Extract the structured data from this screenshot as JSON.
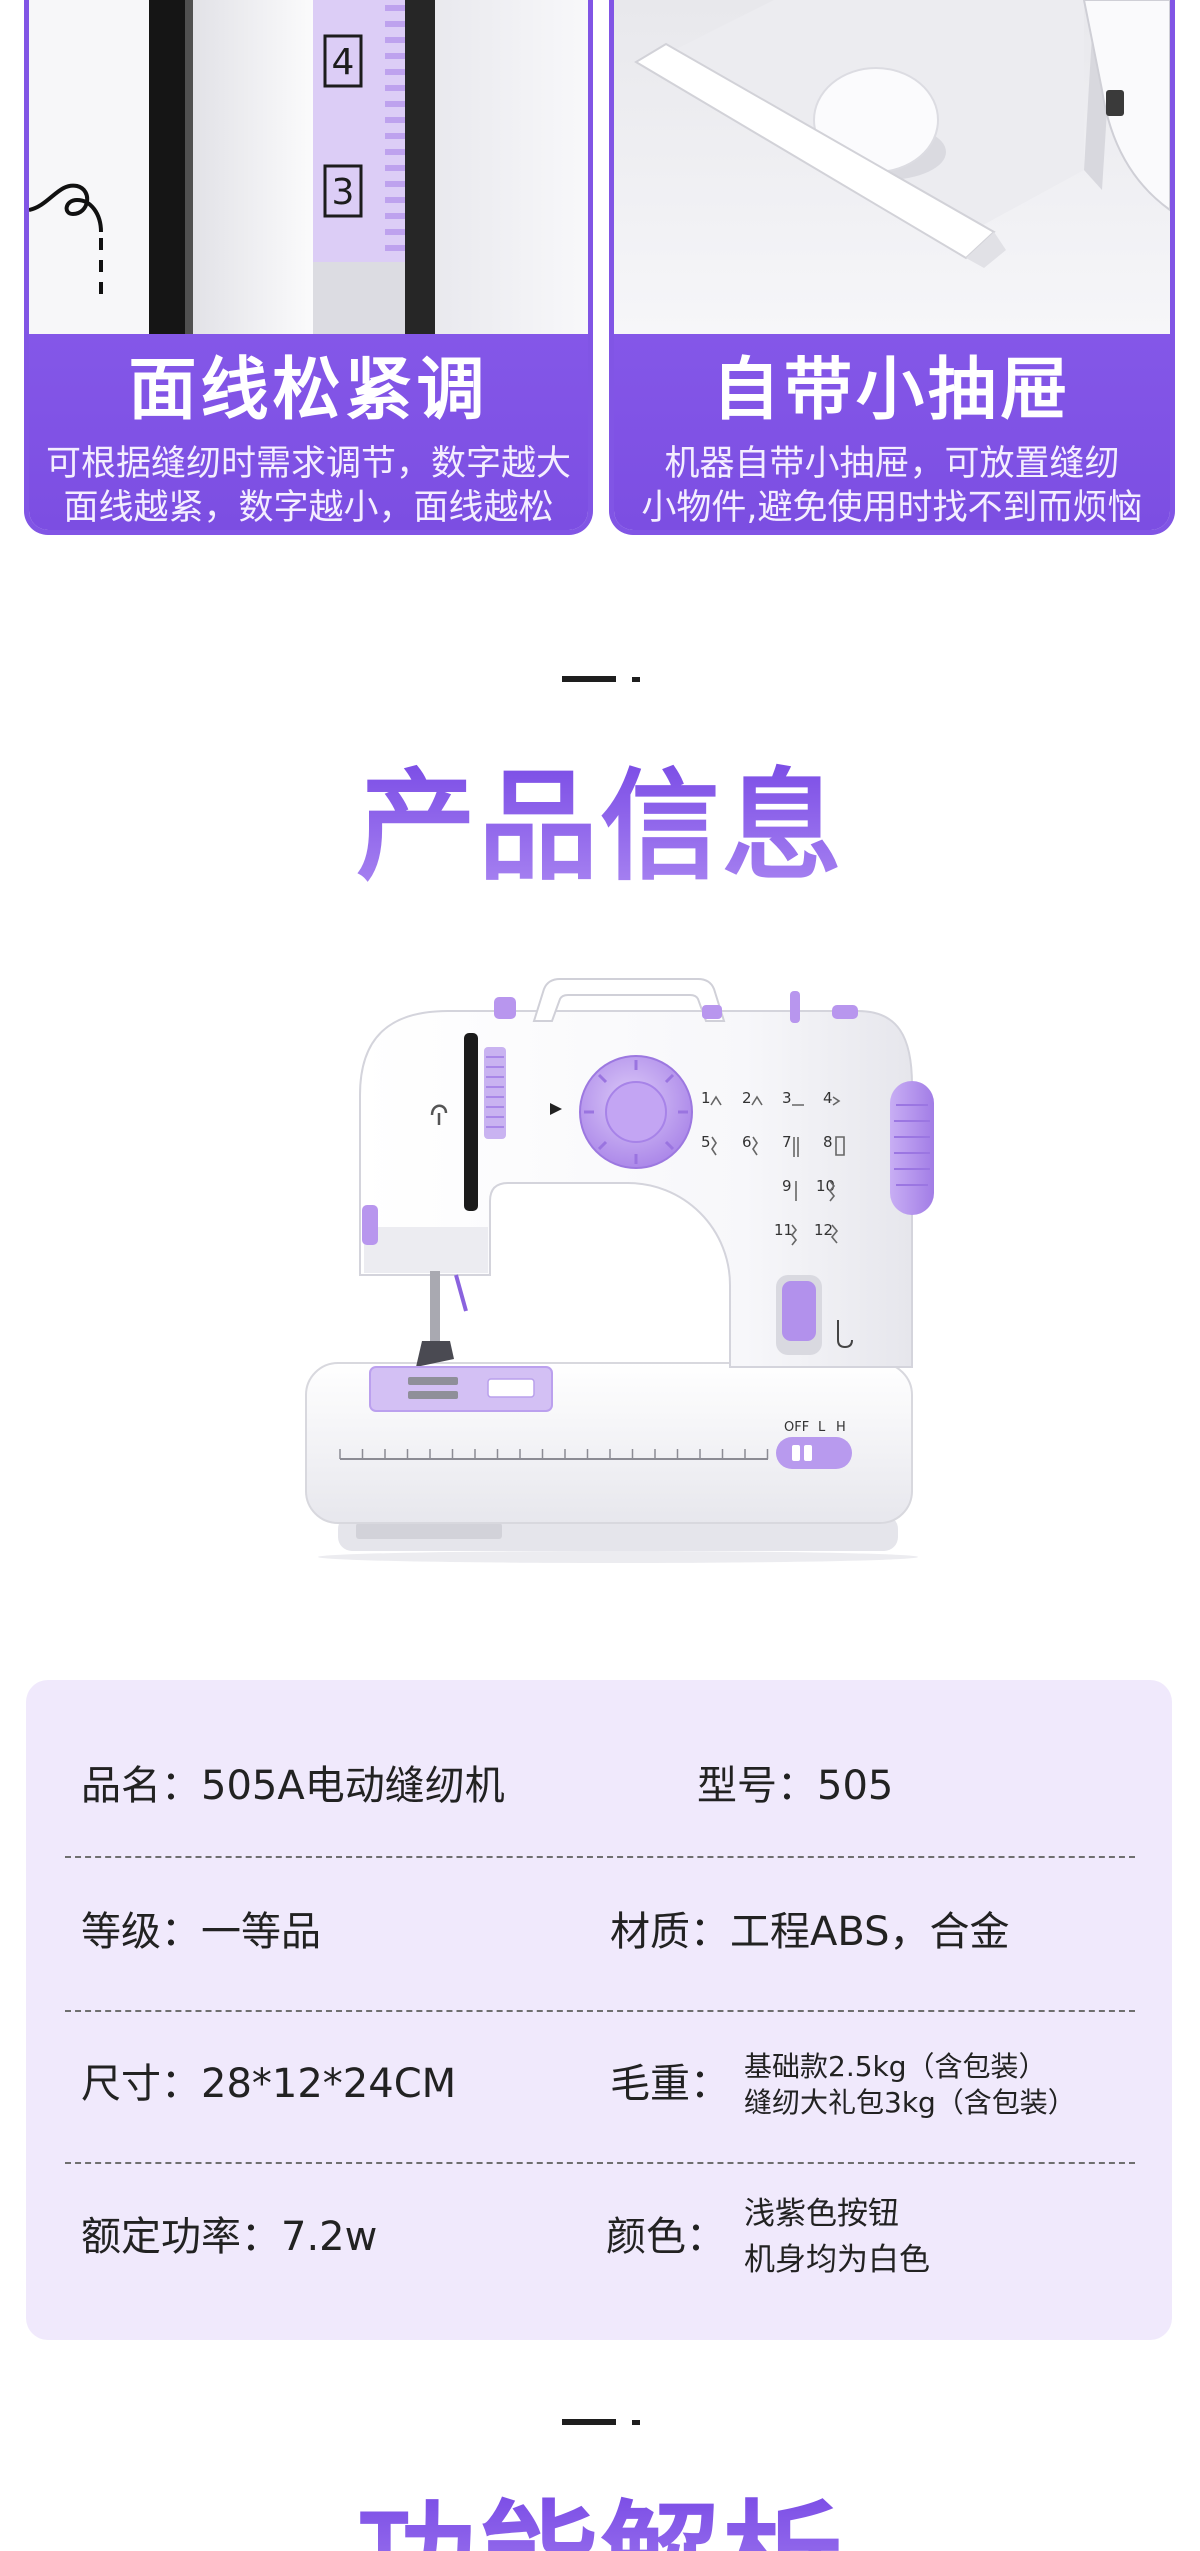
{
  "feature_cards": [
    {
      "title": "面线松紧调",
      "desc_lines": [
        "可根据缝纫时需求调节，数字越大",
        "面线越紧，数字越小，面线越松"
      ],
      "dial_numbers": [
        "4",
        "3"
      ]
    },
    {
      "title": "自带小抽屉",
      "desc_lines": [
        "机器自带小抽屉，可放置缝纫",
        "小物件,避免使用时找不到而烦恼"
      ]
    }
  ],
  "product_info": {
    "title": "产品信息"
  },
  "machine": {
    "stitch_numbers": [
      "1",
      "2",
      "3",
      "4",
      "5",
      "6",
      "7",
      "8",
      "9",
      "10",
      "11",
      "12"
    ],
    "switch_labels": [
      "OFF",
      "L",
      "H"
    ]
  },
  "specs": {
    "rows": [
      {
        "left": "品名：505A电动缝纫机",
        "right": "型号：505"
      },
      {
        "left": "等级：一等品",
        "right": "材质：工程ABS，合金"
      },
      {
        "left": "尺寸：28*12*24CM",
        "right_label": "毛重：",
        "right_lines": [
          "基础款2.5kg（含包装）",
          "缝纫大礼包3kg（含包装）"
        ]
      },
      {
        "left": "额定功率：7.2w",
        "right_label": "颜色：",
        "right_lines": [
          "浅紫色按钮",
          "机身均为白色"
        ]
      }
    ]
  },
  "features": {
    "title": "功能解析"
  },
  "colors": {
    "brand_purple": "#8155E5",
    "heading_gradient": [
      "#7C4EE6",
      "#A884F1"
    ],
    "spec_card_bg": "#F0E9FC",
    "accent_lavender": "#B896EE",
    "text": "#222222"
  }
}
